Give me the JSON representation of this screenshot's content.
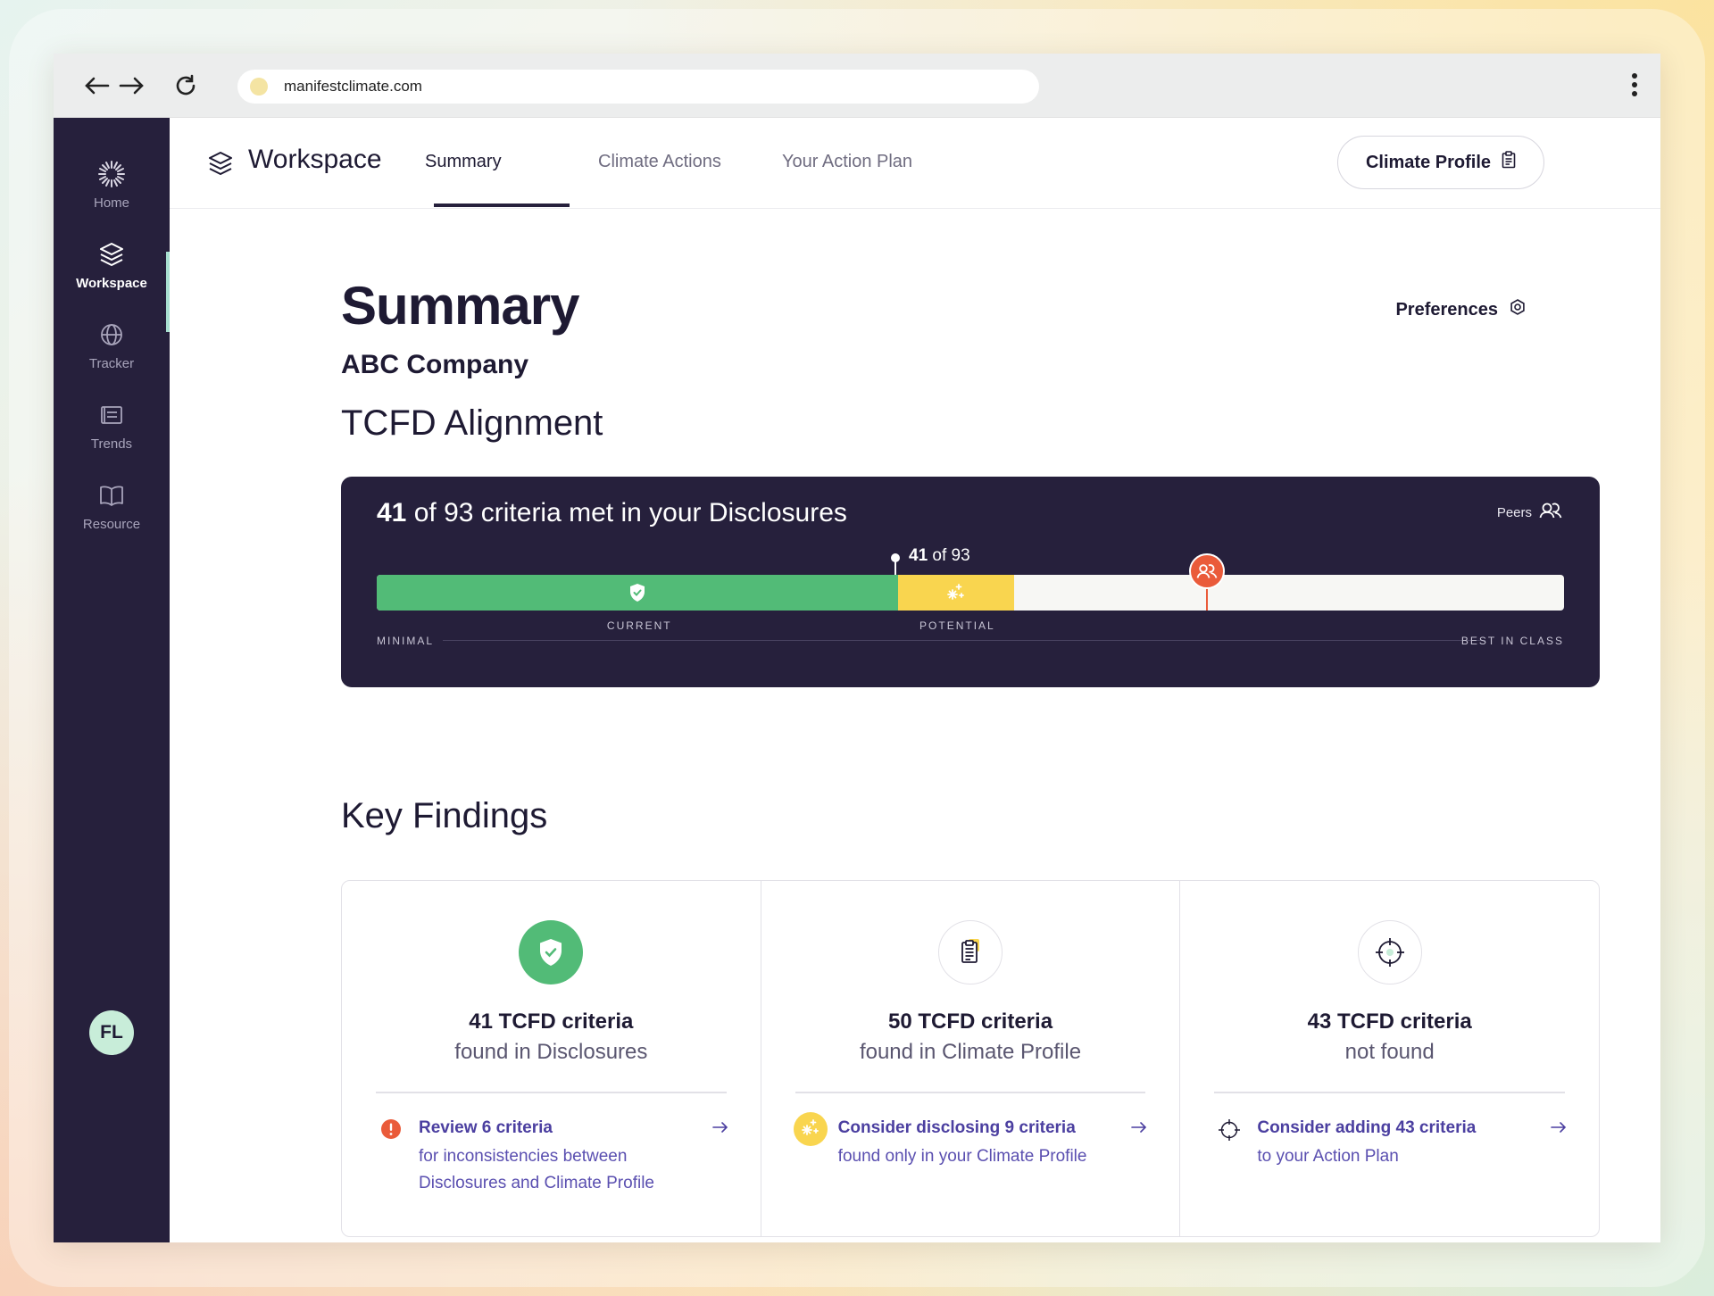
{
  "browser": {
    "url": "manifestclimate.com"
  },
  "sidebar": {
    "items": [
      {
        "label": "Home",
        "icon": "burst-logo-icon"
      },
      {
        "label": "Workspace",
        "icon": "layers-icon",
        "active": true
      },
      {
        "label": "Tracker",
        "icon": "globe-icon"
      },
      {
        "label": "Trends",
        "icon": "news-icon"
      },
      {
        "label": "Resource",
        "icon": "book-icon"
      }
    ],
    "avatar_initials": "FL"
  },
  "header": {
    "title": "Workspace",
    "tabs": [
      {
        "label": "Summary",
        "active": true
      },
      {
        "label": "Climate Actions"
      },
      {
        "label": "Your Action Plan"
      }
    ],
    "profile_button": "Climate Profile"
  },
  "summary": {
    "title": "Summary",
    "company": "ABC Company",
    "preferences_label": "Preferences",
    "section_title": "TCFD Alignment"
  },
  "alignment": {
    "met": "41",
    "headline_rest": " of 93 criteria met in your Disclosures",
    "peers_label": "Peers",
    "marker_value": "41",
    "marker_rest": " of 93",
    "current_fraction": 0.439,
    "potential_fraction": 0.537,
    "peers_fraction": 0.699,
    "current_label": "CURRENT",
    "potential_label": "POTENTIAL",
    "scale_min": "MINIMAL",
    "scale_max": "BEST IN CLASS",
    "colors": {
      "current": "#52bb77",
      "potential": "#f9d54f",
      "peers": "#ea5b3a",
      "panel": "#26203c"
    }
  },
  "key_findings": {
    "title": "Key Findings",
    "cards": [
      {
        "icon": "shield-check-icon",
        "line1": "41 TCFD criteria",
        "line2": "found in Disclosures",
        "action_icon": "alert-icon",
        "action_title": "Review 6 criteria",
        "action_text": "for inconsistencies between Disclosures and Climate Profile"
      },
      {
        "icon": "clipboard-icon",
        "line1": "50 TCFD criteria",
        "line2": "found in Climate Profile",
        "action_icon": "sparkle-icon",
        "action_title": "Consider disclosing 9 criteria",
        "action_text": "found only in your Climate Profile"
      },
      {
        "icon": "crosshair-icon",
        "line1": "43 TCFD criteria",
        "line2": "not found",
        "action_icon": "crosshair-icon",
        "action_title": "Consider adding 43 criteria",
        "action_text": "to your Action Plan"
      }
    ]
  }
}
